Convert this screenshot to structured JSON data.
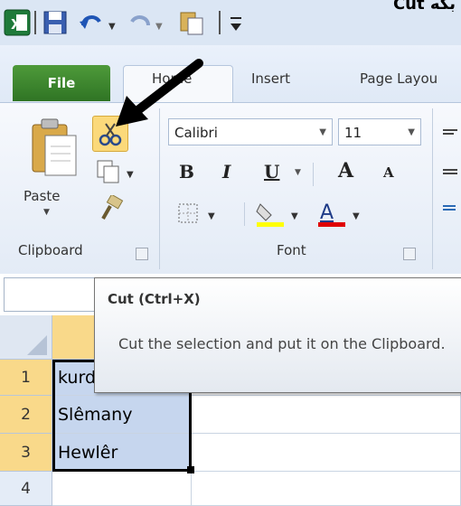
{
  "top_caption": "Cut بکە",
  "quick_access": {
    "icons": [
      "excel-app-icon",
      "save-icon",
      "undo-icon",
      "redo-icon",
      "paste-icon",
      "customize-qat-icon"
    ]
  },
  "tabs": [
    {
      "label": "File",
      "active": false
    },
    {
      "label": "Home",
      "active": true
    },
    {
      "label": "Insert",
      "active": false
    },
    {
      "label": "Page Layou",
      "active": false
    }
  ],
  "ribbon": {
    "clipboard": {
      "paste_label": "Paste",
      "group_label": "Clipboard"
    },
    "font": {
      "font_name": "Calibri",
      "font_size": "11",
      "group_label": "Font",
      "bold": "B",
      "italic": "I",
      "underline": "U",
      "grow": "A",
      "shrink": "A"
    }
  },
  "tooltip": {
    "title": "Cut (Ctrl+X)",
    "description": "Cut the selection and put it on the Clipboard."
  },
  "sheet": {
    "rows": [
      {
        "num": "1",
        "value": "kurd"
      },
      {
        "num": "2",
        "value": "Slêmany"
      },
      {
        "num": "3",
        "value": "Hewlêr"
      },
      {
        "num": "4",
        "value": ""
      }
    ]
  },
  "colors": {
    "file_tab": "#2f7424",
    "ribbon_bg": "#e3ebf6",
    "selection_fill": "#c6d6ee",
    "cut_highlight": "#f9d98a"
  }
}
